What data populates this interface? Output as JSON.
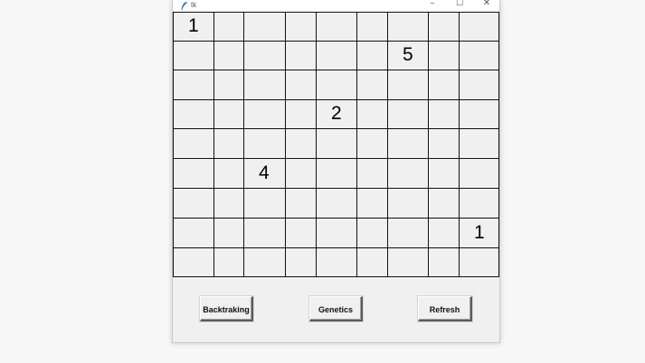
{
  "window": {
    "title": "tk",
    "controls": {
      "minimize": "–",
      "maximize": "☐",
      "close": "✕"
    }
  },
  "board": {
    "rows": 9,
    "cols": 9,
    "numbers": [
      {
        "row": 0,
        "col": 0,
        "value": "1"
      },
      {
        "row": 1,
        "col": 6,
        "value": "5"
      },
      {
        "row": 3,
        "col": 4,
        "value": "2"
      },
      {
        "row": 5,
        "col": 2,
        "value": "4"
      },
      {
        "row": 7,
        "col": 8,
        "value": "1"
      }
    ]
  },
  "buttons": {
    "backtracking": "Backtraking",
    "genetics": "Genetics",
    "refresh": "Refresh"
  }
}
